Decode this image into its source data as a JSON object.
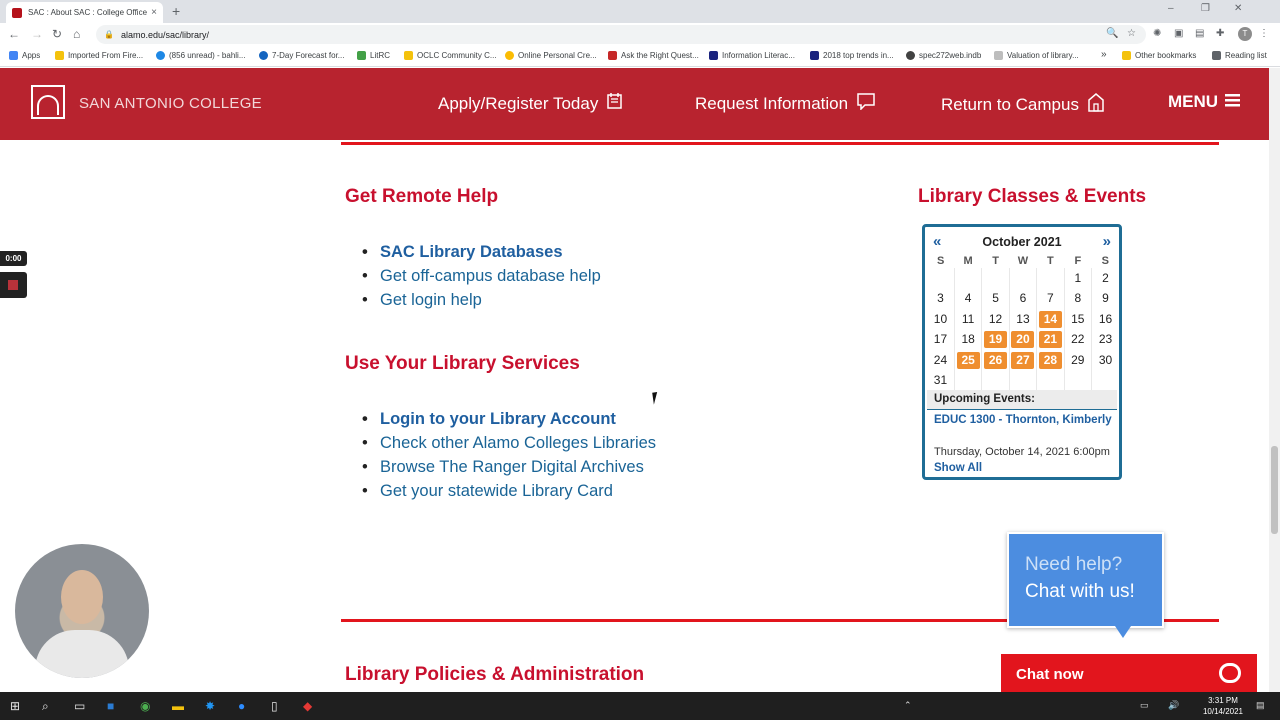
{
  "browser": {
    "tab_title": "SAC : About SAC : College Office...",
    "tab_close": "×",
    "new_tab": "+",
    "url": "alamo.edu/sac/library/",
    "avatar_letter": "T",
    "bookmarks": [
      {
        "label": "Apps",
        "color": "#4285f4"
      },
      {
        "label": "Imported From Fire...",
        "color": "#f4c20d"
      },
      {
        "label": "(856 unread) - bahli...",
        "color": "#1e88e5"
      },
      {
        "label": "7-Day Forecast for...",
        "color": "#1565c0"
      },
      {
        "label": "LitRC",
        "color": "#43a047"
      },
      {
        "label": "OCLC Community C...",
        "color": "#f4c20d"
      },
      {
        "label": "Online Personal Cre...",
        "color": "#fbbc04"
      },
      {
        "label": "Ask the Right Quest...",
        "color": "#c62828"
      },
      {
        "label": "Information Literac...",
        "color": "#1a237e"
      },
      {
        "label": "2018 top trends in...",
        "color": "#1a237e"
      },
      {
        "label": "spec272web.indb",
        "color": "#424242"
      },
      {
        "label": "Valuation of library...",
        "color": "#bdbdbd"
      },
      {
        "label": "»",
        "color": ""
      },
      {
        "label": "Other bookmarks",
        "color": "#f4c20d"
      },
      {
        "label": "Reading list",
        "color": "#5f6368"
      }
    ]
  },
  "header": {
    "college_name": "SAN ANTONIO COLLEGE",
    "nav": {
      "apply": "Apply/Register Today",
      "request": "Request Information",
      "return": "Return to Campus",
      "menu": "MENU"
    }
  },
  "main": {
    "remote_help": {
      "title": "Get Remote Help",
      "links": [
        "SAC Library Databases",
        "Get off-campus database help",
        "Get login help"
      ]
    },
    "services": {
      "title": "Use Your Library Services",
      "links": [
        "Login to your Library Account",
        "Check other Alamo Colleges Libraries",
        "Browse The Ranger Digital Archives",
        "Get your statewide Library Card"
      ]
    },
    "policies_title": "Library Policies & Administration"
  },
  "calendar": {
    "title": "Library Classes & Events",
    "prev": "«",
    "next": "»",
    "month": "October 2021",
    "weekdays": [
      "S",
      "M",
      "T",
      "W",
      "T",
      "F",
      "S"
    ],
    "weeks": [
      [
        "",
        "",
        "",
        "",
        "",
        "1",
        "2"
      ],
      [
        "3",
        "4",
        "5",
        "6",
        "7",
        "8",
        "9"
      ],
      [
        "10",
        "11",
        "12",
        "13",
        "14",
        "15",
        "16"
      ],
      [
        "17",
        "18",
        "19",
        "20",
        "21",
        "22",
        "23"
      ],
      [
        "24",
        "25",
        "26",
        "27",
        "28",
        "29",
        "30"
      ],
      [
        "31",
        "",
        "",
        "",
        "",
        "",
        ""
      ]
    ],
    "event_days": [
      "14",
      "19",
      "20",
      "21",
      "25",
      "26",
      "27",
      "28"
    ],
    "event_color": "#ef8e2f",
    "upcoming_label": "Upcoming Events:",
    "event_title": "EDUC 1300 - Thornton, Kimberly",
    "event_date": "Thursday, October 14, 2021 6:00pm",
    "show_all": "Show All"
  },
  "chat": {
    "line1": "Need help?",
    "line2": "Chat with us!",
    "button": "Chat now"
  },
  "recording": {
    "time": "0:00"
  },
  "taskbar": {
    "time": "3:31 PM",
    "date": "10/14/2021"
  },
  "colors": {
    "header_red": "#b8232f",
    "accent_red": "#c8102e",
    "link_blue": "#1a6496",
    "chat_blue": "#4c8de0"
  }
}
